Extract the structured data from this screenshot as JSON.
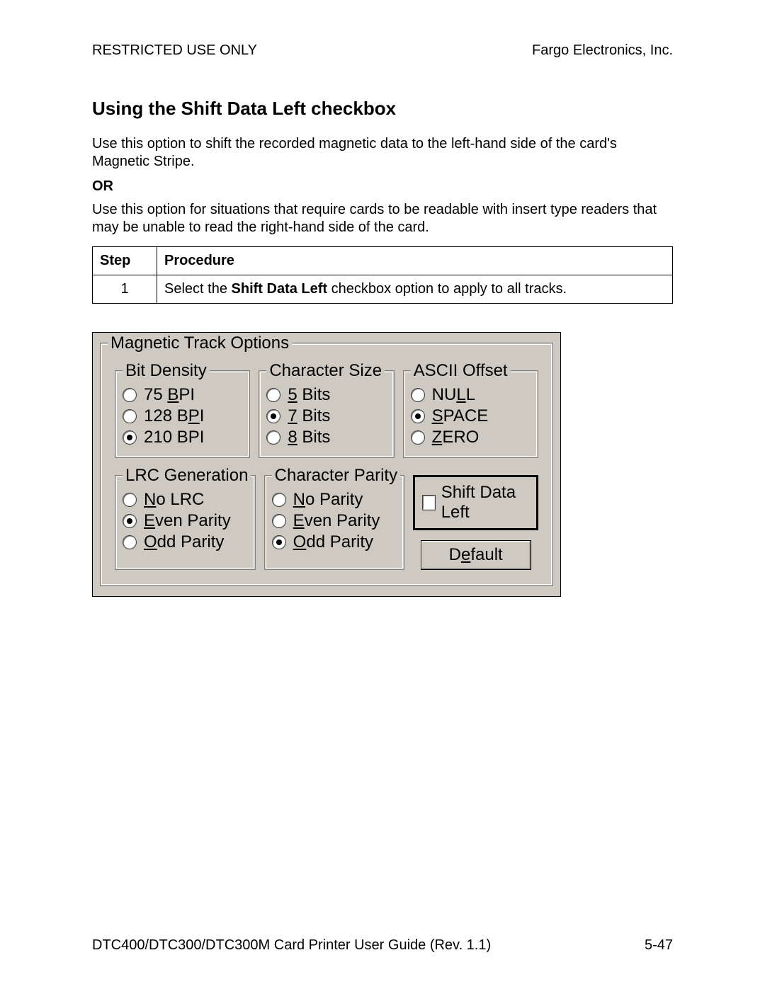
{
  "header": {
    "left": "RESTRICTED USE ONLY",
    "right": "Fargo Electronics, Inc."
  },
  "title": "Using the Shift Data Left checkbox",
  "para1": "Use this option to shift the recorded magnetic data to the left-hand side of the card's Magnetic Stripe.",
  "or": "OR",
  "para2": "Use this option for situations that require cards to be readable with insert type readers that may be unable to read the right-hand side of the card.",
  "table": {
    "headers": {
      "step": "Step",
      "proc": "Procedure"
    },
    "rows": [
      {
        "step": "1",
        "pre": "Select the ",
        "bold": "Shift Data Left",
        "post": " checkbox option to apply to all tracks."
      }
    ]
  },
  "dialog": {
    "main_legend": "Magnetic Track Options",
    "bit_density": {
      "legend": "Bit Density",
      "opt75_pre": "  75 ",
      "opt75_u": "B",
      "opt75_post": "PI",
      "opt128_pre": "128 B",
      "opt128_u": "P",
      "opt128_post": "I",
      "opt210": "210 BPI",
      "selected": "210"
    },
    "char_size": {
      "legend": "Character Size",
      "opt5_u": "5",
      "opt5_post": " Bits",
      "opt7_u": "7",
      "opt7_post": " Bits",
      "opt8_u": "8",
      "opt8_post": " Bits",
      "selected": "7"
    },
    "ascii": {
      "legend": "ASCII Offset",
      "null_pre": "NU",
      "null_u": "L",
      "null_post": "L",
      "space_u": "S",
      "space_post": "PACE",
      "zero_u": "Z",
      "zero_post": "ERO",
      "selected": "SPACE"
    },
    "lrc": {
      "legend": "LRC Generation",
      "no_u": "N",
      "no_post": "o LRC",
      "even_u": "E",
      "even_post": "ven Parity",
      "odd_u": "O",
      "odd_post": "dd Parity",
      "selected": "Even"
    },
    "parity": {
      "legend": "Character Parity",
      "no_u": "N",
      "no_post": "o Parity",
      "even_u": "E",
      "even_post": "ven Parity",
      "odd_u": "O",
      "odd_post": "dd Parity",
      "selected": "Odd"
    },
    "shift_label": "Shift Data Left",
    "shift_checked": false,
    "default_pre": "D",
    "default_u": "e",
    "default_post": "fault"
  },
  "footer": {
    "left": "DTC400/DTC300/DTC300M Card Printer User Guide (Rev. 1.1)",
    "right": "5-47"
  }
}
